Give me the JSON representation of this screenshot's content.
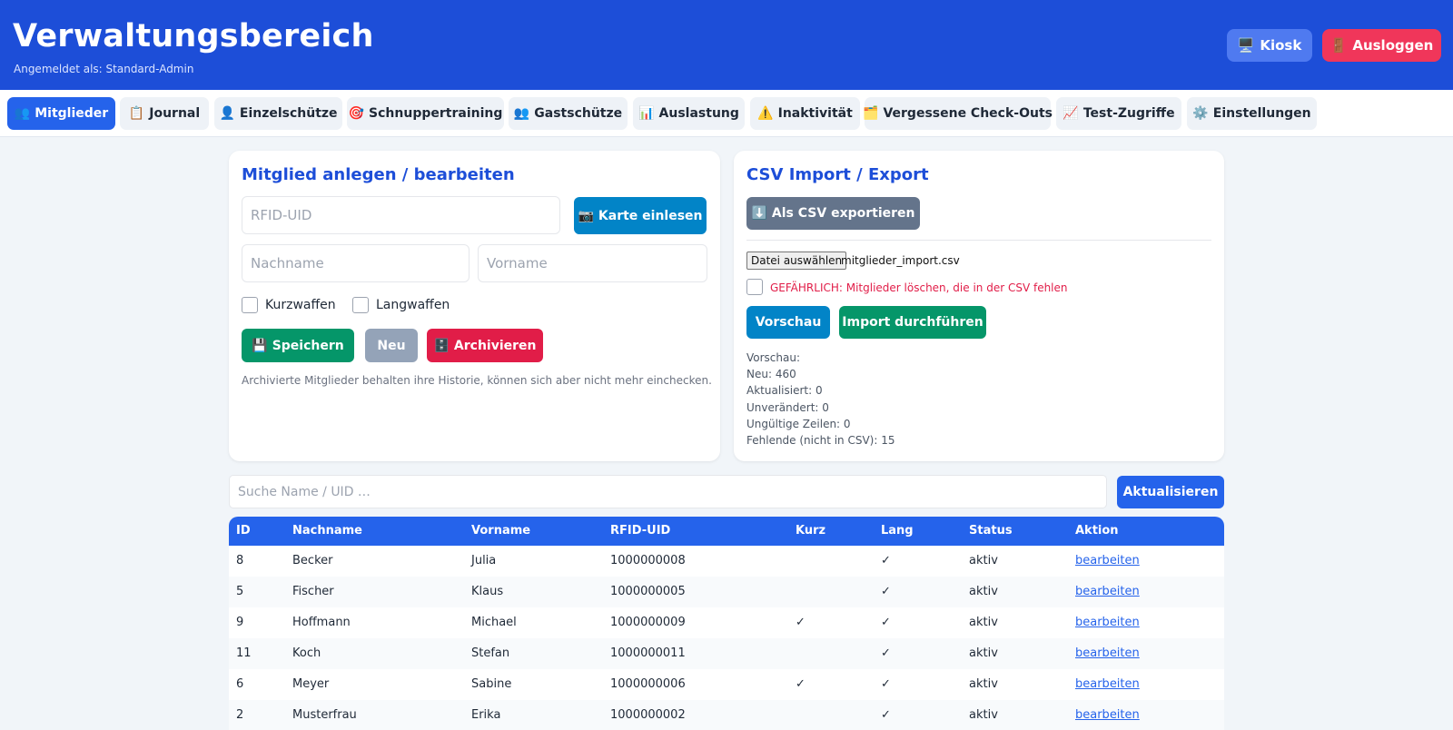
{
  "header": {
    "title": "Verwaltungsbereich",
    "subtitle": "Angemeldet als: Standard-Admin",
    "kiosk_icon": "🖥️",
    "kiosk_label": "Kiosk",
    "logout_icon": "🚪",
    "logout_label": "Ausloggen"
  },
  "tabs": [
    {
      "icon": "👥",
      "label": "Mitglieder"
    },
    {
      "icon": "📋",
      "label": "Journal"
    },
    {
      "icon": "👤",
      "label": "Einzelschütze"
    },
    {
      "icon": "🎯",
      "label": "Schnuppertraining"
    },
    {
      "icon": "👥",
      "label": "Gastschütze"
    },
    {
      "icon": "📊",
      "label": "Auslastung"
    },
    {
      "icon": "⚠️",
      "label": "Inaktivität"
    },
    {
      "icon": "🗂️",
      "label": "Vergessene Check-Outs"
    },
    {
      "icon": "📈",
      "label": "Test-Zugriffe"
    },
    {
      "icon": "⚙️",
      "label": "Einstellungen"
    }
  ],
  "member_form": {
    "title": "Mitglied anlegen / bearbeiten",
    "rfid_placeholder": "RFID-UID",
    "read_card_icon": "📷",
    "read_card_label": "Karte einlesen",
    "lastname_placeholder": "Nachname",
    "firstname_placeholder": "Vorname",
    "kurzwaffen_label": "Kurzwaffen",
    "langwaffen_label": "Langwaffen",
    "save_icon": "💾",
    "save_label": "Speichern",
    "new_label": "Neu",
    "archive_icon": "🗄️",
    "archive_label": "Archivieren",
    "note": "Archivierte Mitglieder behalten ihre Historie, können sich aber nicht mehr einchecken."
  },
  "csv": {
    "title": "CSV Import / Export",
    "export_icon": "⬇️",
    "export_label": "Als CSV exportieren",
    "file_button_label": "Datei auswählen",
    "file_name": "mitglieder_import.csv",
    "danger_label": "GEFÄHRLICH: Mitglieder löschen, die in der CSV fehlen",
    "preview_button": "Vorschau",
    "import_button": "Import durchführen",
    "preview_lines": [
      "Vorschau:",
      "Neu: 460",
      "Aktualisiert: 0",
      "Unverändert: 0",
      "Ungültige Zeilen: 0",
      "Fehlende (nicht in CSV): 15"
    ]
  },
  "search": {
    "placeholder": "Suche Name / UID …",
    "refresh_label": "Aktualisieren"
  },
  "table": {
    "headers": [
      "ID",
      "Nachname",
      "Vorname",
      "RFID-UID",
      "Kurz",
      "Lang",
      "Status",
      "Aktion"
    ],
    "rows": [
      {
        "id": "8",
        "nachname": "Becker",
        "vorname": "Julia",
        "uid": "1000000008",
        "kurz": "",
        "lang": "✓",
        "status": "aktiv",
        "aktion": "bearbeiten"
      },
      {
        "id": "5",
        "nachname": "Fischer",
        "vorname": "Klaus",
        "uid": "1000000005",
        "kurz": "",
        "lang": "✓",
        "status": "aktiv",
        "aktion": "bearbeiten"
      },
      {
        "id": "9",
        "nachname": "Hoffmann",
        "vorname": "Michael",
        "uid": "1000000009",
        "kurz": "✓",
        "lang": "✓",
        "status": "aktiv",
        "aktion": "bearbeiten"
      },
      {
        "id": "11",
        "nachname": "Koch",
        "vorname": "Stefan",
        "uid": "1000000011",
        "kurz": "",
        "lang": "✓",
        "status": "aktiv",
        "aktion": "bearbeiten"
      },
      {
        "id": "6",
        "nachname": "Meyer",
        "vorname": "Sabine",
        "uid": "1000000006",
        "kurz": "✓",
        "lang": "✓",
        "status": "aktiv",
        "aktion": "bearbeiten"
      },
      {
        "id": "2",
        "nachname": "Musterfrau",
        "vorname": "Erika",
        "uid": "1000000002",
        "kurz": "",
        "lang": "✓",
        "status": "aktiv",
        "aktion": "bearbeiten"
      }
    ]
  }
}
